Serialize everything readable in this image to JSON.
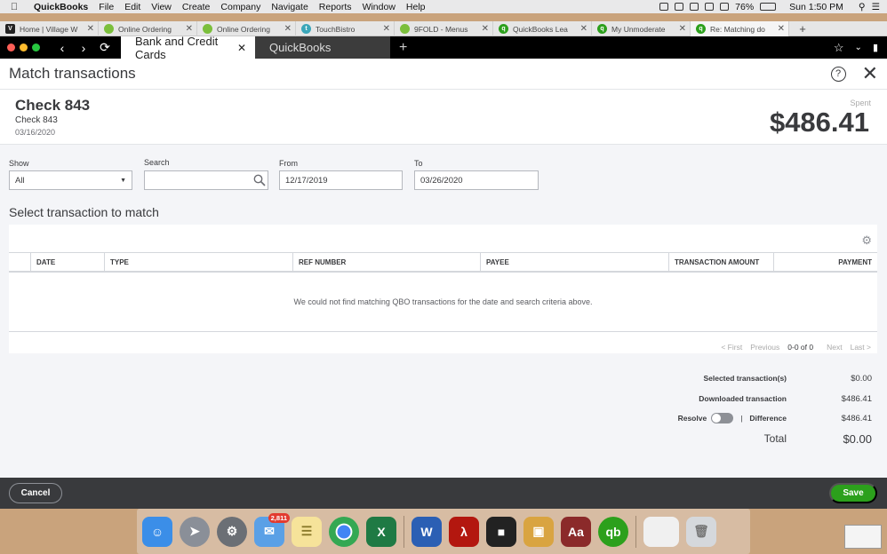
{
  "menubar": {
    "app_name": "QuickBooks",
    "items": [
      "File",
      "Edit",
      "View",
      "Create",
      "Company",
      "Navigate",
      "Reports",
      "Window",
      "Help"
    ],
    "battery": "76%",
    "clock": "Sun 1:50 PM"
  },
  "browser_tabs": [
    {
      "label": "Home | Village W",
      "color": "#222222",
      "glyph": "V"
    },
    {
      "label": "Online Ordering",
      "color": "#7bbf3c",
      "glyph": ""
    },
    {
      "label": "Online Ordering",
      "color": "#7bbf3c",
      "glyph": ""
    },
    {
      "label": "TouchBistro",
      "color": "#3aa6b9",
      "glyph": "t"
    },
    {
      "label": "9FOLD - Menus",
      "color": "#7bbf3c",
      "glyph": ""
    },
    {
      "label": "QuickBooks Lea",
      "color": "#2ca01c",
      "glyph": "q"
    },
    {
      "label": "My Unmoderate",
      "color": "#2ca01c",
      "glyph": "q"
    },
    {
      "label": "Re: Matching do",
      "color": "#2ca01c",
      "glyph": "q"
    }
  ],
  "app_tabs": {
    "active": "Bank and Credit Cards",
    "inactive": "QuickBooks"
  },
  "modal": {
    "title": "Match transactions",
    "check_title": "Check 843",
    "check_subtitle": "Check 843",
    "check_date": "03/16/2020",
    "spent_label": "Spent",
    "spent_amount": "$486.41"
  },
  "filters": {
    "show_label": "Show",
    "show_value": "All",
    "search_label": "Search",
    "search_value": "",
    "from_label": "From",
    "from_value": "12/17/2019",
    "to_label": "To",
    "to_value": "03/26/2020"
  },
  "section_title": "Select transaction to match",
  "table": {
    "columns": [
      "DATE",
      "TYPE",
      "REF NUMBER",
      "PAYEE",
      "TRANSACTION AMOUNT",
      "PAYMENT"
    ],
    "empty_message": "We could not find matching QBO transactions for the date and search criteria above."
  },
  "pager": {
    "first": "< First",
    "previous": "Previous",
    "range": "0-0 of 0",
    "next": "Next",
    "last": "Last >"
  },
  "summary": {
    "selected_label": "Selected transaction(s)",
    "selected_value": "$0.00",
    "downloaded_label": "Downloaded transaction",
    "downloaded_value": "$486.41",
    "resolve_label": "Resolve",
    "difference_label": "Difference",
    "difference_value": "$486.41",
    "total_label": "Total",
    "total_value": "$0.00"
  },
  "footer": {
    "cancel_label": "Cancel",
    "save_label": "Save"
  },
  "dock": {
    "mail_badge": "2,811"
  },
  "colors": {
    "brand_green": "#2ca01c",
    "footer_bg": "#393a3d",
    "text": "#393a3d"
  }
}
